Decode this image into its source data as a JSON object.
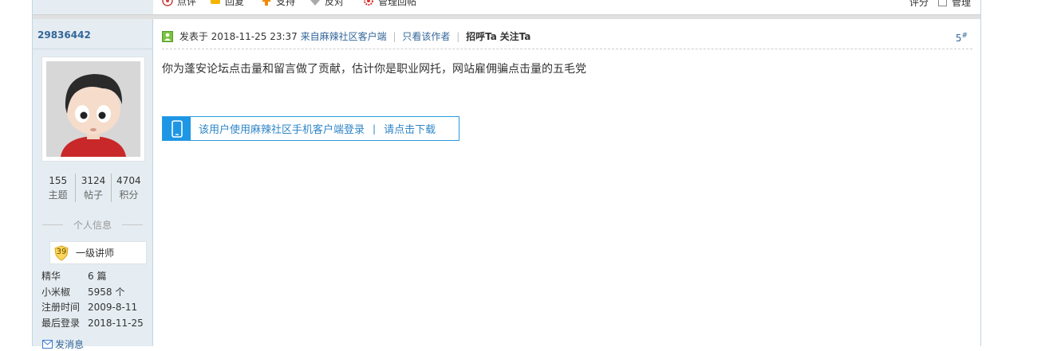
{
  "prev_actions": {
    "comment": "点评",
    "reply": "回复",
    "support": "支持",
    "oppose": "反对",
    "manage": "管理回帖",
    "rate": "评分",
    "admin": "管理"
  },
  "user": {
    "username": "29836442",
    "stats": [
      {
        "value": "155",
        "label": "主题"
      },
      {
        "value": "3124",
        "label": "帖子"
      },
      {
        "value": "4704",
        "label": "积分"
      }
    ],
    "section_title": "个人信息",
    "rank_level": "39",
    "rank_name": "一级讲师",
    "info": [
      {
        "key": "精华",
        "value": "6 篇"
      },
      {
        "key": "小米椒",
        "value": "5958 个"
      },
      {
        "key": "注册时间",
        "value": "2009-8-11"
      },
      {
        "key": "最后登录",
        "value": "2018-11-25"
      }
    ],
    "send_pm": "发消息"
  },
  "post": {
    "posted_prefix": "发表于",
    "posted_time": "2018-11-25 23:37",
    "source": "来自麻辣社区客户端",
    "only_author": "只看该作者",
    "greet": "招呼Ta",
    "follow": "关注Ta",
    "floor_number": "5",
    "floor_mark": "#",
    "message": "你为蓬安论坛点击量和留言做了贡献，估计你是职业网托，网站雇佣骗点击量的五毛党",
    "mobile_login_text": "该用户使用麻辣社区手机客户端登录",
    "mobile_divider": "|",
    "mobile_download": "请点击下载"
  },
  "colors": {
    "sidebar_bg": "#e5edf2",
    "link": "#336699",
    "mobile_accent": "#1e96e6"
  }
}
